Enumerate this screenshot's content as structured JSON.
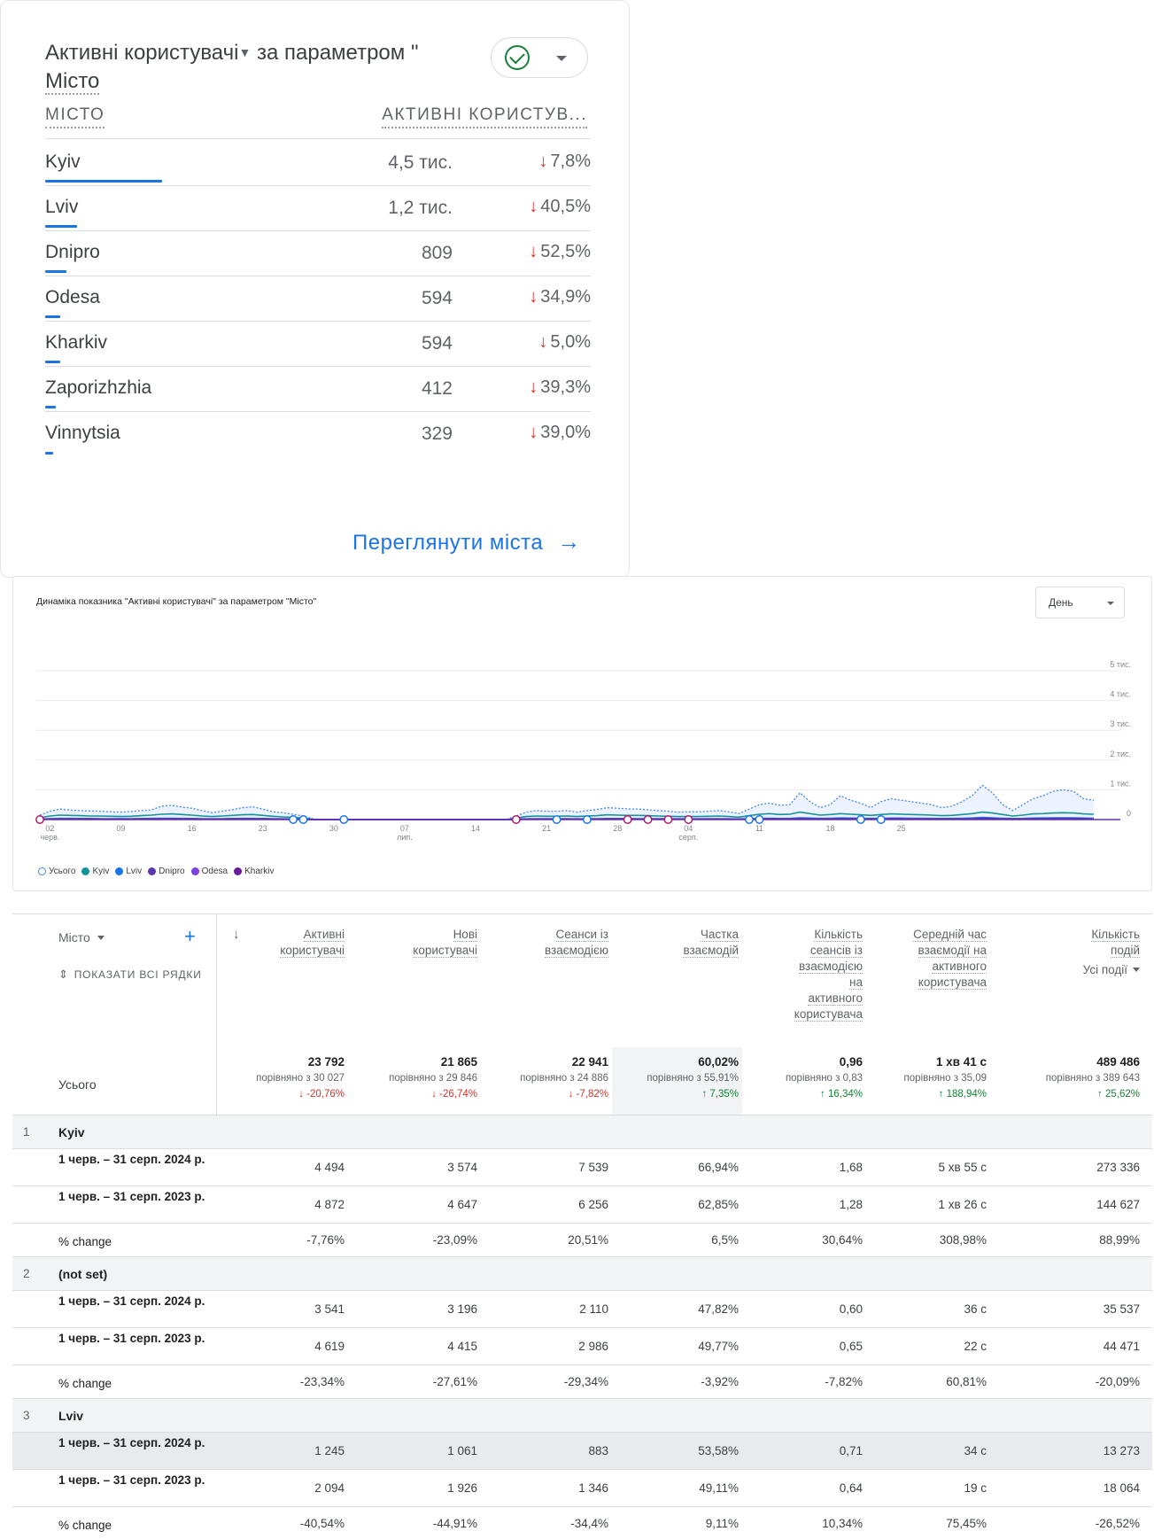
{
  "city_card": {
    "title_metric": "Активні користувачі",
    "title_mid": " за параметром \"",
    "title_dim": "Місто",
    "col_city": "МІСТО",
    "col_users": "АКТИВНІ КОРИСТУВ...",
    "rows": [
      {
        "city": "Kyiv",
        "value": "4,5 тис.",
        "change": "7,8%",
        "share": 1.0
      },
      {
        "city": "Lviv",
        "value": "1,2 тис.",
        "change": "40,5%",
        "share": 0.27
      },
      {
        "city": "Dnipro",
        "value": "809",
        "change": "52,5%",
        "share": 0.18
      },
      {
        "city": "Odesa",
        "value": "594",
        "change": "34,9%",
        "share": 0.13
      },
      {
        "city": "Kharkiv",
        "value": "594",
        "change": "5,0%",
        "share": 0.13
      },
      {
        "city": "Zaporizhzhia",
        "value": "412",
        "change": "39,3%",
        "share": 0.09
      },
      {
        "city": "Vinnytsia",
        "value": "329",
        "change": "39,0%",
        "share": 0.07
      }
    ],
    "view_link": "Переглянути міста",
    "colors": {
      "bar": "#1a73e8",
      "down": "#d93025",
      "check": "#188038"
    }
  },
  "chart_card": {
    "title": "Динаміка показника \"Активні користувачі\" за параметром \"Місто\"",
    "granularity": "День",
    "legend": [
      "Усього",
      "Kyiv",
      "Lviv",
      "Dnipro",
      "Odesa",
      "Kharkiv"
    ]
  },
  "chart_data": {
    "type": "line",
    "title": "Динаміка показника \"Активні користувачі\" за параметром \"Місто\"",
    "ylim": [
      0,
      5000
    ],
    "yticks": [
      "0",
      "1 тис.",
      "2 тис.",
      "3 тис.",
      "4 тис.",
      "5 тис."
    ],
    "xticks": [
      {
        "day": 1,
        "label": "02",
        "sub": "черв."
      },
      {
        "day": 8,
        "label": "09",
        "sub": ""
      },
      {
        "day": 15,
        "label": "16",
        "sub": ""
      },
      {
        "day": 22,
        "label": "23",
        "sub": ""
      },
      {
        "day": 29,
        "label": "30",
        "sub": ""
      },
      {
        "day": 36,
        "label": "07",
        "sub": "лип."
      },
      {
        "day": 43,
        "label": "14",
        "sub": ""
      },
      {
        "day": 50,
        "label": "21",
        "sub": ""
      },
      {
        "day": 57,
        "label": "28",
        "sub": ""
      },
      {
        "day": 64,
        "label": "04",
        "sub": "серп."
      },
      {
        "day": 71,
        "label": "11",
        "sub": ""
      },
      {
        "day": 78,
        "label": "18",
        "sub": ""
      },
      {
        "day": 85,
        "label": "25",
        "sub": ""
      }
    ],
    "x_start": "2024-06-01",
    "series": [
      {
        "name": "Усього",
        "color": "#4285f4",
        "style": "dotted-area",
        "values": [
          150,
          280,
          350,
          320,
          300,
          290,
          280,
          260,
          250,
          270,
          300,
          320,
          450,
          480,
          420,
          380,
          300,
          230,
          280,
          330,
          400,
          430,
          350,
          260,
          230,
          180,
          120,
          20,
          0,
          0,
          0,
          0,
          0,
          0,
          0,
          0,
          0,
          0,
          0,
          0,
          0,
          0,
          0,
          0,
          0,
          0,
          0,
          120,
          250,
          300,
          280,
          280,
          300,
          250,
          300,
          340,
          400,
          380,
          360,
          350,
          330,
          300,
          280,
          250,
          260,
          260,
          280,
          300,
          260,
          200,
          350,
          500,
          550,
          480,
          500,
          900,
          600,
          400,
          500,
          800,
          650,
          550,
          400,
          600,
          700,
          650,
          600,
          550,
          500,
          400,
          450,
          600,
          800,
          1150,
          900,
          500,
          300,
          500,
          700,
          800,
          950,
          1000,
          950,
          700,
          650
        ]
      },
      {
        "name": "Kyiv",
        "color": "#12939a",
        "values": [
          60,
          120,
          150,
          140,
          130,
          120,
          120,
          110,
          100,
          110,
          130,
          150,
          180,
          190,
          170,
          150,
          120,
          100,
          120,
          140,
          160,
          170,
          140,
          110,
          90,
          70,
          50,
          10,
          0,
          0,
          0,
          0,
          0,
          0,
          0,
          0,
          0,
          0,
          0,
          0,
          0,
          0,
          0,
          0,
          0,
          0,
          0,
          50,
          100,
          120,
          110,
          110,
          120,
          100,
          120,
          130,
          160,
          150,
          140,
          140,
          130,
          120,
          110,
          100,
          100,
          100,
          110,
          120,
          100,
          80,
          130,
          180,
          200,
          170,
          180,
          250,
          200,
          150,
          170,
          200,
          180,
          160,
          140,
          170,
          190,
          180,
          170,
          160,
          150,
          130,
          140,
          170,
          200,
          250,
          220,
          170,
          120,
          150,
          190,
          200,
          220,
          230,
          220,
          190,
          180
        ]
      },
      {
        "name": "Lviv",
        "color": "#1a73e8",
        "values": [
          20,
          30,
          40,
          40,
          35,
          35,
          30,
          30,
          30,
          30,
          35,
          40,
          45,
          45,
          40,
          35,
          30,
          25,
          30,
          35,
          40,
          40,
          35,
          30,
          25,
          20,
          15,
          5,
          0,
          0,
          0,
          0,
          0,
          0,
          0,
          0,
          0,
          0,
          0,
          0,
          0,
          0,
          0,
          0,
          0,
          0,
          0,
          15,
          25,
          30,
          30,
          30,
          30,
          25,
          30,
          30,
          35,
          35,
          35,
          30,
          30,
          30,
          30,
          25,
          25,
          25,
          30,
          30,
          25,
          20,
          30,
          40,
          45,
          40,
          40,
          60,
          50,
          40,
          45,
          55,
          50,
          45,
          40,
          45,
          50,
          50,
          45,
          45,
          40,
          35,
          40,
          45,
          55,
          70,
          60,
          45,
          35,
          40,
          50,
          55,
          60,
          60,
          60,
          50,
          45
        ]
      },
      {
        "name": "Dnipro",
        "color": "#5e35b1",
        "values": [
          10,
          15,
          20,
          20,
          20,
          18,
          18,
          18,
          16,
          16,
          18,
          20,
          24,
          24,
          22,
          20,
          18,
          16,
          18,
          20,
          22,
          22,
          20,
          18,
          16,
          14,
          10,
          3,
          0,
          0,
          0,
          0,
          0,
          0,
          0,
          0,
          0,
          0,
          0,
          0,
          0,
          0,
          0,
          0,
          0,
          0,
          0,
          10,
          14,
          16,
          16,
          16,
          16,
          14,
          16,
          18,
          20,
          20,
          18,
          18,
          18,
          16,
          16,
          14,
          14,
          14,
          16,
          16,
          14,
          12,
          16,
          22,
          24,
          22,
          22,
          30,
          26,
          22,
          24,
          28,
          26,
          24,
          22,
          24,
          26,
          26,
          24,
          24,
          22,
          20,
          22,
          24,
          28,
          34,
          30,
          24,
          20,
          22,
          26,
          28,
          30,
          30,
          30,
          26,
          24
        ]
      },
      {
        "name": "Odesa",
        "color": "#7b3fe4",
        "values": [
          8,
          12,
          16,
          16,
          15,
          15,
          14,
          14,
          13,
          13,
          14,
          16,
          18,
          18,
          17,
          16,
          14,
          12,
          14,
          16,
          18,
          18,
          16,
          14,
          12,
          10,
          8,
          2,
          0,
          0,
          0,
          0,
          0,
          0,
          0,
          0,
          0,
          0,
          0,
          0,
          0,
          0,
          0,
          0,
          0,
          0,
          0,
          8,
          11,
          12,
          12,
          12,
          12,
          11,
          12,
          14,
          16,
          16,
          15,
          14,
          14,
          13,
          13,
          12,
          12,
          12,
          13,
          13,
          12,
          10,
          13,
          17,
          18,
          17,
          17,
          22,
          20,
          17,
          18,
          21,
          20,
          18,
          17,
          18,
          20,
          20,
          18,
          18,
          17,
          16,
          17,
          18,
          21,
          26,
          23,
          18,
          16,
          17,
          20,
          21,
          23,
          23,
          23,
          20,
          18
        ]
      },
      {
        "name": "Kharkiv",
        "color": "#6a1b9a",
        "values": [
          8,
          11,
          14,
          14,
          14,
          13,
          13,
          12,
          12,
          12,
          13,
          14,
          16,
          17,
          16,
          14,
          13,
          11,
          13,
          14,
          16,
          16,
          14,
          13,
          11,
          9,
          7,
          2,
          0,
          0,
          0,
          0,
          0,
          0,
          0,
          0,
          0,
          0,
          0,
          0,
          0,
          0,
          0,
          0,
          0,
          0,
          0,
          7,
          10,
          11,
          11,
          11,
          11,
          10,
          11,
          13,
          14,
          14,
          14,
          13,
          13,
          12,
          12,
          11,
          11,
          11,
          12,
          12,
          11,
          9,
          12,
          15,
          17,
          15,
          15,
          20,
          18,
          15,
          16,
          19,
          18,
          16,
          15,
          16,
          18,
          18,
          16,
          16,
          15,
          14,
          15,
          16,
          19,
          23,
          21,
          16,
          14,
          15,
          18,
          19,
          21,
          21,
          21,
          18,
          16
        ]
      }
    ],
    "annotation_markers": [
      {
        "day": 0,
        "color": "#b0186d"
      },
      {
        "day": 25,
        "color": "#1a73e8"
      },
      {
        "day": 26,
        "color": "#1a73e8"
      },
      {
        "day": 30,
        "color": "#1a73e8"
      },
      {
        "day": 47,
        "color": "#b0186d"
      },
      {
        "day": 51,
        "color": "#1a73e8"
      },
      {
        "day": 54,
        "color": "#1a73e8"
      },
      {
        "day": 58,
        "color": "#b0186d"
      },
      {
        "day": 60,
        "color": "#b0186d"
      },
      {
        "day": 62,
        "color": "#b0186d"
      },
      {
        "day": 64,
        "color": "#b0186d"
      },
      {
        "day": 70,
        "color": "#1a73e8"
      },
      {
        "day": 71,
        "color": "#1a73e8"
      },
      {
        "day": 81,
        "color": "#1a73e8"
      },
      {
        "day": 83,
        "color": "#1a73e8"
      }
    ],
    "grid": true,
    "legend_position": "bottom-left"
  },
  "table": {
    "dimension": "Місто",
    "show_all": "ПОКАЗАТИ ВСІ РЯДКИ",
    "columns": [
      "Активні користувачі",
      "Нові користувачі",
      "Сеанси із взаємодією",
      "Частка взаємодій",
      "Кількість сеансів із взаємодією на активного користувача",
      "Середній час взаємодії на активного користувача",
      "Кількість подій"
    ],
    "events_filter": "Усі події",
    "total_label": "Усього",
    "totals": [
      {
        "value": "23 792",
        "compare": "порівняно з 30 027",
        "change": "↓ -20,76%",
        "dir": "down"
      },
      {
        "value": "21 865",
        "compare": "порівняно з 29 846",
        "change": "↓ -26,74%",
        "dir": "down"
      },
      {
        "value": "22 941",
        "compare": "порівняно з 24 886",
        "change": "↓ -7,82%",
        "dir": "down"
      },
      {
        "value": "60,02%",
        "compare": "порівняно з 55,91%",
        "change": "↑ 7,35%",
        "dir": "up"
      },
      {
        "value": "0,96",
        "compare": "порівняно з 0,83",
        "change": "↑ 16,34%",
        "dir": "up"
      },
      {
        "value": "1 хв 41 с",
        "compare": "порівняно з 35,09",
        "change": "↑ 188,94%",
        "dir": "up"
      },
      {
        "value": "489 486",
        "compare": "порівняно з 389 643",
        "change": "↑ 25,62%",
        "dir": "up"
      }
    ],
    "groups": [
      {
        "index": "1",
        "name": "Kyiv",
        "rows": [
          {
            "label": "1 черв. – 31 серп. 2024 р.",
            "cells": [
              "4 494",
              "3 574",
              "7 539",
              "66,94%",
              "1,68",
              "5 хв 55 с",
              "273 336"
            ]
          },
          {
            "label": "1 черв. – 31 серп. 2023 р.",
            "cells": [
              "4 872",
              "4 647",
              "6 256",
              "62,85%",
              "1,28",
              "1 хв 26 с",
              "144 627"
            ]
          },
          {
            "label": "% change",
            "cells": [
              "-7,76%",
              "-23,09%",
              "20,51%",
              "6,5%",
              "30,64%",
              "308,98%",
              "88,99%"
            ]
          }
        ]
      },
      {
        "index": "2",
        "name": "(not set)",
        "rows": [
          {
            "label": "1 черв. – 31 серп. 2024 р.",
            "cells": [
              "3 541",
              "3 196",
              "2 110",
              "47,82%",
              "0,60",
              "36 с",
              "35 537"
            ]
          },
          {
            "label": "1 черв. – 31 серп. 2023 р.",
            "cells": [
              "4 619",
              "4 415",
              "2 986",
              "49,77%",
              "0,65",
              "22 с",
              "44 471"
            ]
          },
          {
            "label": "% change",
            "cells": [
              "-23,34%",
              "-27,61%",
              "-29,34%",
              "-3,92%",
              "-7,82%",
              "60,81%",
              "-20,09%"
            ]
          }
        ]
      },
      {
        "index": "3",
        "name": "Lviv",
        "rows": [
          {
            "label": "1 черв. – 31 серп. 2024 р.",
            "cells": [
              "1 245",
              "1 061",
              "883",
              "53,58%",
              "0,71",
              "34 с",
              "13 273"
            ]
          },
          {
            "label": "1 черв. – 31 серп. 2023 р.",
            "cells": [
              "2 094",
              "1 926",
              "1 346",
              "49,11%",
              "0,64",
              "19 с",
              "18 064"
            ]
          },
          {
            "label": "% change",
            "cells": [
              "-40,54%",
              "-44,91%",
              "-34,4%",
              "9,11%",
              "10,34%",
              "75,45%",
              "-26,52%"
            ]
          }
        ]
      }
    ]
  }
}
